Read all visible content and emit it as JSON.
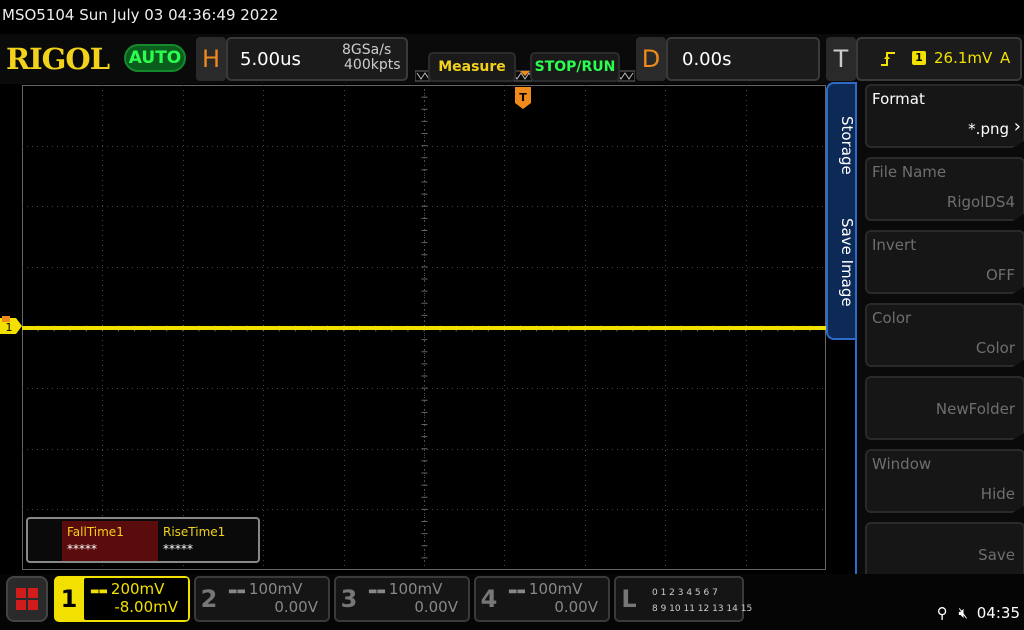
{
  "title_bar": {
    "text": "MSO5104  Sun July 03 04:36:49 2022"
  },
  "header": {
    "logo": "RIGOL",
    "mode": "AUTO",
    "horizontal": {
      "letter": "H",
      "timebase": "5.00us",
      "sample_rate": "8GSa/s",
      "memory_depth": "400kpts"
    },
    "measure_label": "Measure",
    "stoprun_label": "STOP/RUN",
    "delay": {
      "letter": "D",
      "value": "0.00s"
    },
    "trigger": {
      "letter": "T",
      "source": "1",
      "level": "26.1mV",
      "mode": "A",
      "slope_icon": "rising-edge-icon"
    }
  },
  "measurements": [
    {
      "name": "FallTime1",
      "value": "*****"
    },
    {
      "name": "RiseTime1",
      "value": "*****"
    }
  ],
  "menu": {
    "tabs": [
      "Storage",
      "Save Image"
    ],
    "items": [
      {
        "label": "Format",
        "value": "*.png",
        "enabled": true,
        "has_arrow": true
      },
      {
        "label": "File Name",
        "value": "RigolDS4",
        "enabled": false
      },
      {
        "label": "Invert",
        "value": "OFF",
        "enabled": false
      },
      {
        "label": "Color",
        "value": "Color",
        "enabled": false
      },
      {
        "label": "",
        "value": "NewFolder",
        "enabled": false
      },
      {
        "label": "Window",
        "value": "Hide",
        "enabled": false
      },
      {
        "label": "",
        "value": "Save",
        "enabled": false
      }
    ]
  },
  "channels": [
    {
      "num": "1",
      "scale": "200mV",
      "offset": "-8.00mV",
      "active": true
    },
    {
      "num": "2",
      "scale": "100mV",
      "offset": "0.00V",
      "active": false
    },
    {
      "num": "3",
      "scale": "100mV",
      "offset": "0.00V",
      "active": false
    },
    {
      "num": "4",
      "scale": "100mV",
      "offset": "0.00V",
      "active": false
    }
  ],
  "logic": {
    "letter": "L",
    "row1": "0 1 2 3  4 5 6 7",
    "row2": "8 9 10 11  12 13 14 15"
  },
  "status": {
    "time": "04:35",
    "icons": [
      "usb-icon",
      "speaker-muted-icon"
    ]
  },
  "colors": {
    "ch1": "#f2e000",
    "accent_blue": "#2e6ac8",
    "orange": "#f08a1c",
    "green": "#2bff4e"
  }
}
